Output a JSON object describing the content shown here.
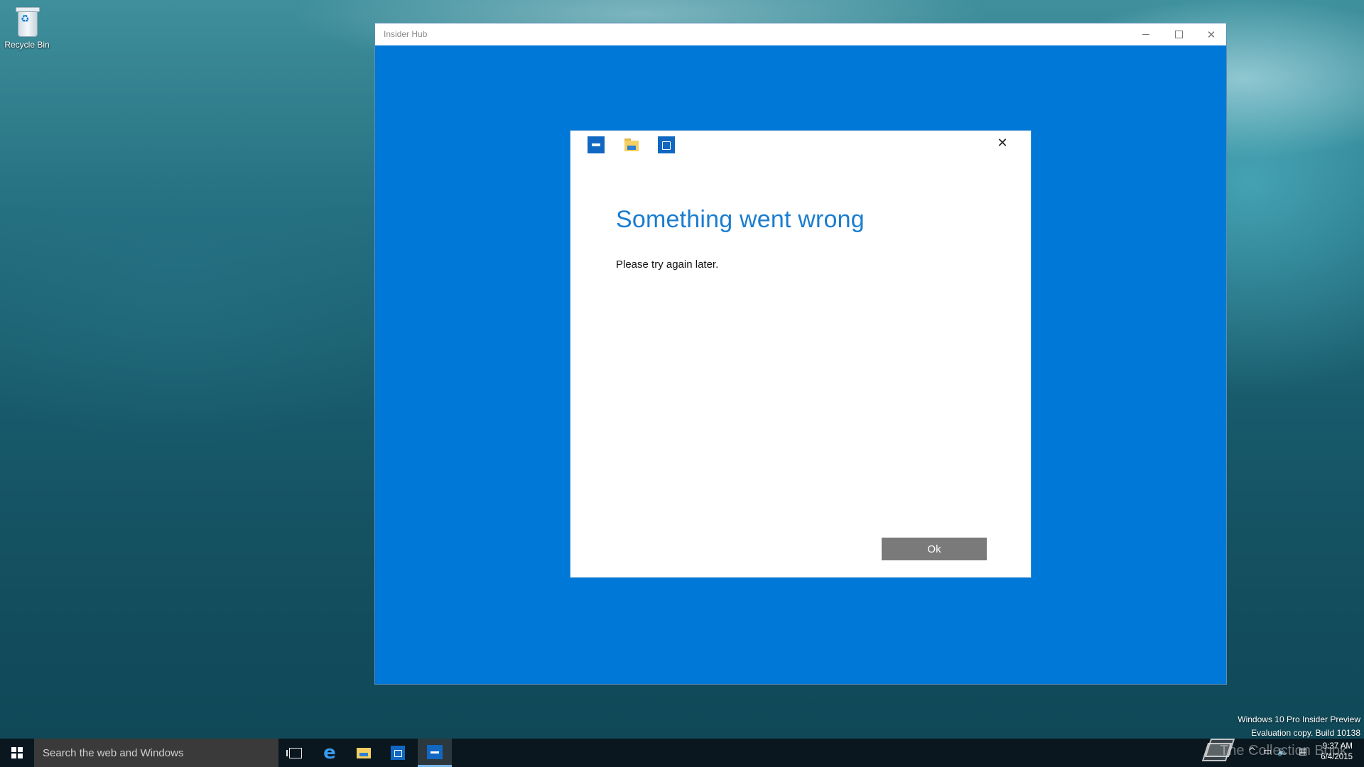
{
  "desktop": {
    "icons": [
      {
        "label": "Recycle Bin",
        "icon": "recycle-bin-icon"
      }
    ]
  },
  "window": {
    "title": "Insider Hub",
    "controls": {
      "minimize": "minimize-icon",
      "maximize": "maximize-icon",
      "close": "close-icon"
    },
    "accent": "#0078d7"
  },
  "dialog": {
    "icons": [
      "insider-hub-icon",
      "file-explorer-icon",
      "store-icon"
    ],
    "title": "Something went wrong",
    "message": "Please try again later.",
    "ok_label": "Ok",
    "title_color": "#1a7dd0"
  },
  "watermark": {
    "line1": "Windows 10 Pro Insider Preview",
    "line2": "Evaluation copy. Build 10138"
  },
  "taskbar": {
    "search_placeholder": "Search the web and Windows",
    "pinned": [
      "task-view-icon",
      "edge-icon",
      "file-explorer-icon",
      "store-icon",
      "insider-hub-icon"
    ],
    "overlay_text": "The Collection Book",
    "clock": {
      "time": "9:37 AM",
      "date": "6/4/2015"
    }
  }
}
